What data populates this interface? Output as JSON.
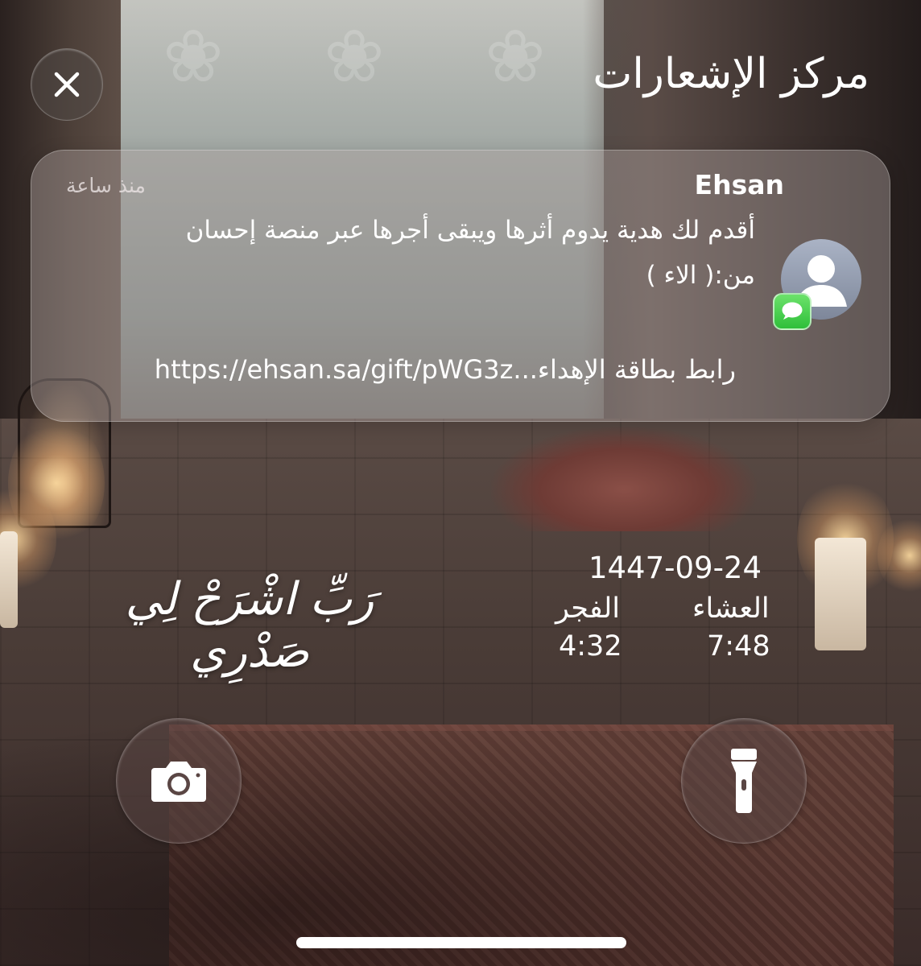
{
  "header": {
    "title": "مركز الإشعارات",
    "close_icon": "close-icon"
  },
  "notification": {
    "sender": "Ehsan",
    "time": "منذ ساعة",
    "message_line1": "أقدم لك هدية يدوم أثرها ويبقى أجرها عبر منصة إحسان",
    "message_line2": "من:( الاء )",
    "link": "رابط بطاقة الإهداء...https://ehsan.sa/gift/pWG3z",
    "avatar_icon": "person-icon",
    "app_badge_icon": "messages-icon"
  },
  "widgets": {
    "hijri_date": "1447-09-24",
    "prayers": [
      {
        "name": "العشاء",
        "time": "7:48"
      },
      {
        "name": "الفجر",
        "time": "4:32"
      }
    ],
    "verse": "رَبِّ اشْرَحْ لِي صَدْرِي"
  },
  "controls": {
    "camera_icon": "camera-icon",
    "flashlight_icon": "flashlight-icon"
  },
  "colors": {
    "text": "#ffffff",
    "card": "#afa2a0",
    "badge": "#34c759"
  }
}
